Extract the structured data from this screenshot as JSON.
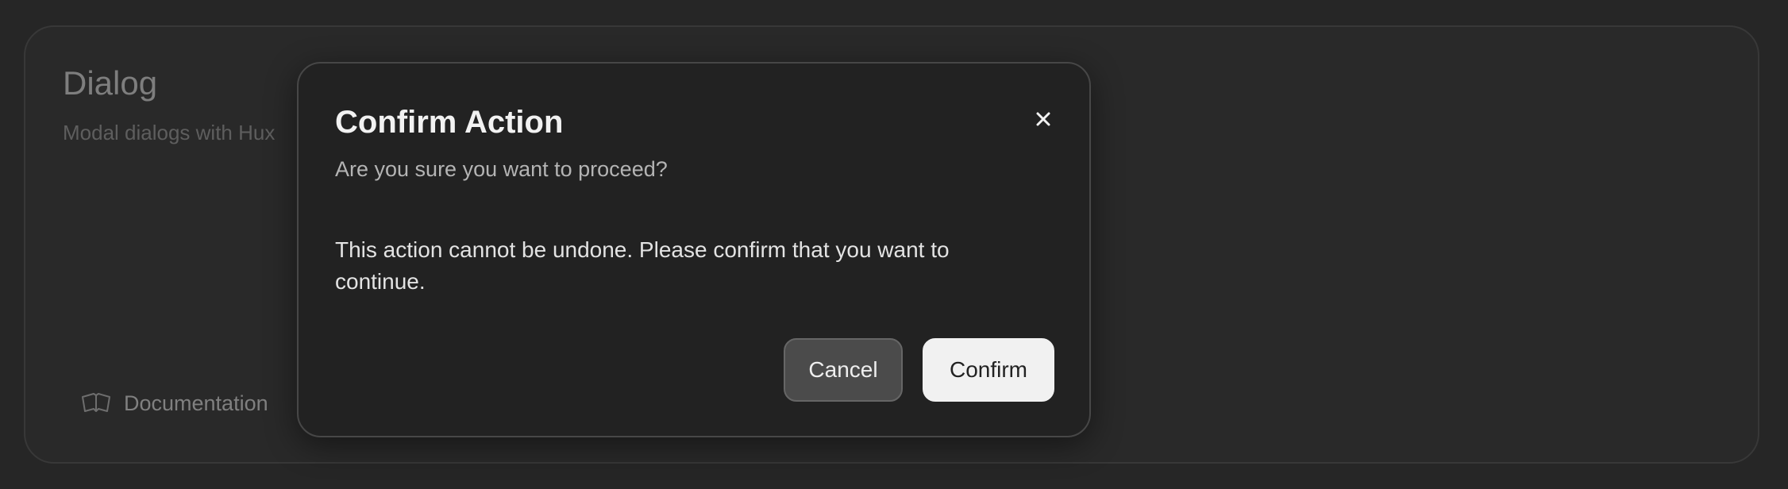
{
  "card": {
    "title": "Dialog",
    "subtitle": "Modal dialogs with Hux",
    "doc_link": "Documentation",
    "doc_icon": "book-open-icon"
  },
  "dialog": {
    "title": "Confirm Action",
    "description": "Are you sure you want to proceed?",
    "body": "This action cannot be undone. Please confirm that you want to continue.",
    "close_icon": "close-icon",
    "cancel_label": "Cancel",
    "confirm_label": "Confirm"
  },
  "colors": {
    "background": "#262626",
    "dialog_background": "#222222",
    "confirm_button": "#f1f1f1",
    "cancel_button": "#4b4b4b"
  }
}
